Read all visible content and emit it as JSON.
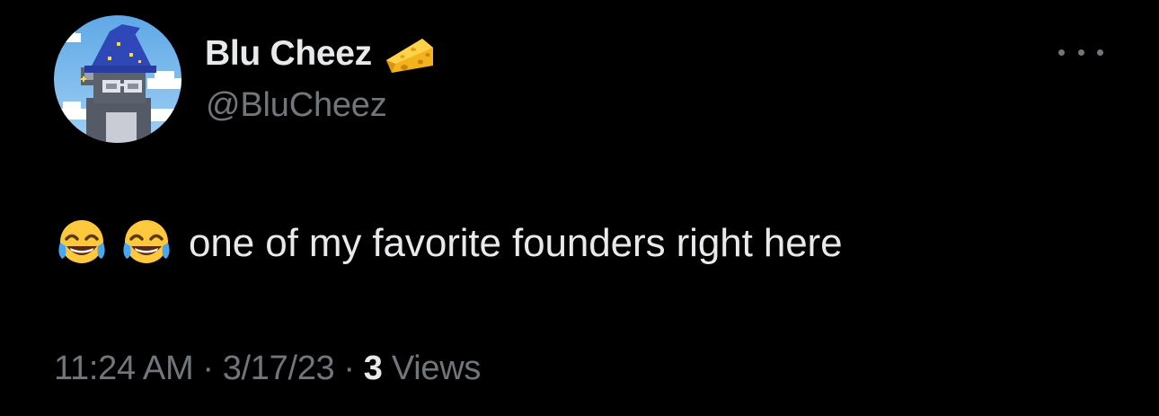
{
  "author": {
    "display_name": "Blu Cheez",
    "handle": "@BluCheez",
    "badge_icon": "cheese-icon",
    "avatar_icon": "pixel-wizard-avatar"
  },
  "tweet": {
    "emojis": [
      "face-with-tears-of-joy-icon",
      "face-with-tears-of-joy-icon"
    ],
    "text": "one of my favorite founders right here"
  },
  "meta": {
    "time": "11:24 AM",
    "separator": "·",
    "date": "3/17/23",
    "views_count": "3",
    "views_label": "Views"
  },
  "colors": {
    "background": "#000000",
    "primary_text": "#e7e9ea",
    "secondary_text": "#71767b"
  }
}
